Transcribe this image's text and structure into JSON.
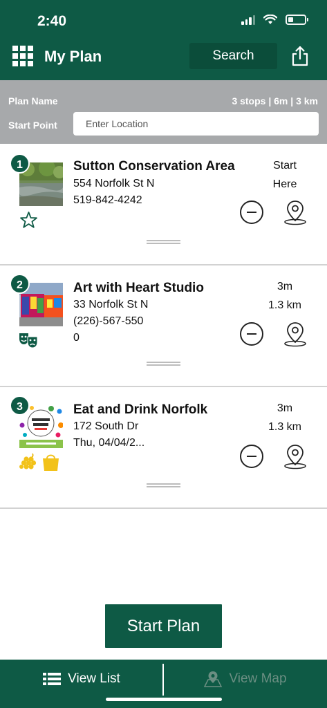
{
  "status_bar": {
    "time": "2:40"
  },
  "header": {
    "title": "My Plan",
    "search_label": "Search"
  },
  "plan": {
    "name_label": "Plan Name",
    "stats": "3 stops | 6m | 3 km",
    "start_point_label": "Start Point",
    "start_placeholder": "Enter Location"
  },
  "stops": [
    {
      "number": "1",
      "name": "Sutton Conservation Area",
      "lines": [
        "554 Norfolk St N",
        "519-842-4242"
      ],
      "meta": [
        "Start",
        "Here"
      ],
      "category_icons": [
        "star-outline-icon"
      ]
    },
    {
      "number": "2",
      "name": "Art with Heart Studio",
      "lines": [
        "33 Norfolk St N",
        "(226)-567-550",
        "0"
      ],
      "meta": [
        "3m",
        "1.3 km"
      ],
      "category_icons": [
        "theater-masks-icon"
      ]
    },
    {
      "number": "3",
      "name": "Eat and Drink Norfolk",
      "lines": [
        "172 South Dr",
        "Thu, 04/04/2..."
      ],
      "meta": [
        "3m",
        "1.3 km"
      ],
      "category_icons": [
        "grapes-icon",
        "shopping-bag-icon"
      ]
    }
  ],
  "start_plan_label": "Start Plan",
  "tabs": {
    "view_list": "View List",
    "view_map": "View Map"
  },
  "colors": {
    "primary": "#0e5a45",
    "header_gray": "#a7a9ab",
    "accent_yellow": "#f2c21a"
  }
}
